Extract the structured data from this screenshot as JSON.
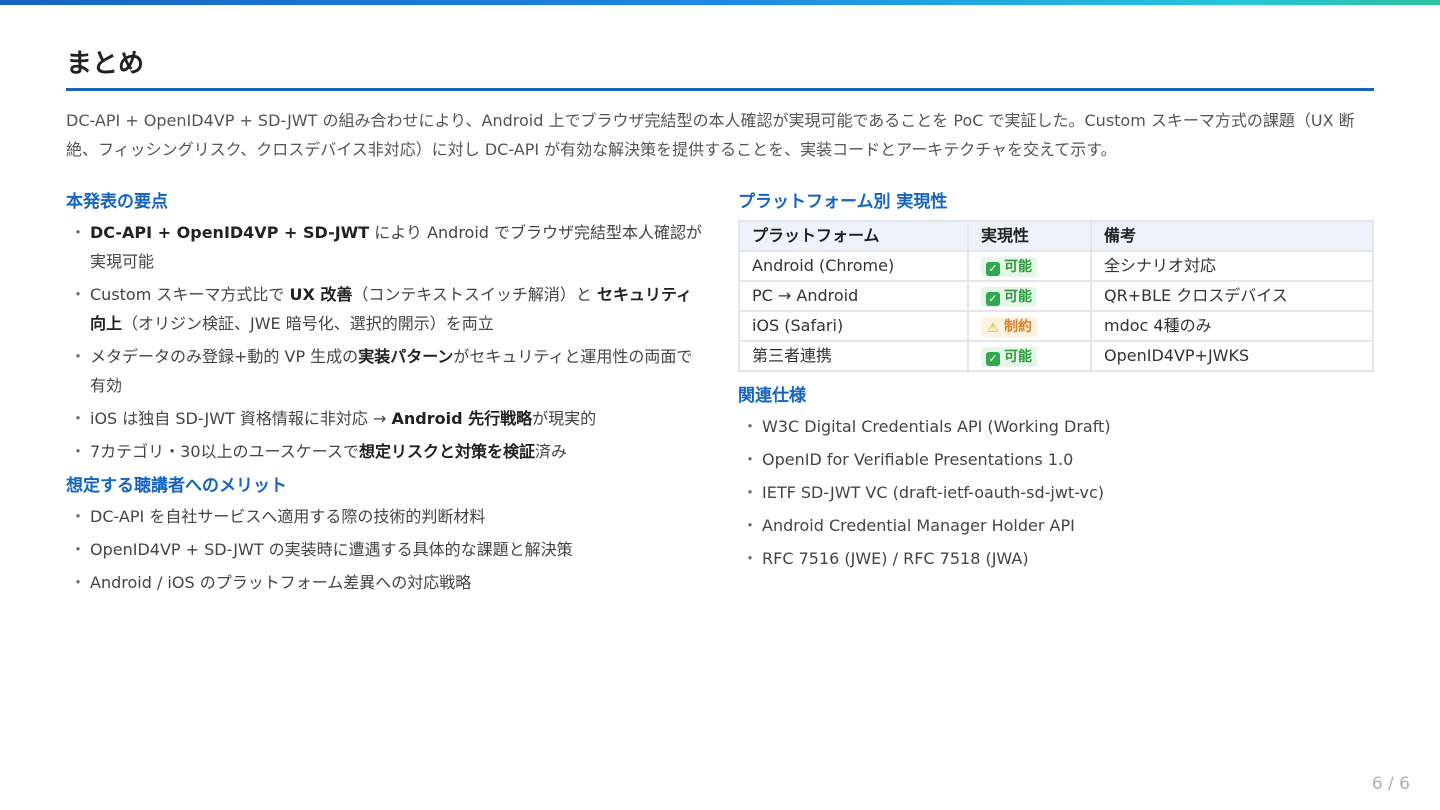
{
  "slide": {
    "title": "まとめ",
    "intro": "DC-API + OpenID4VP + SD-JWT の組み合わせにより、Android 上でブラウザ完結型の本人確認が実現可能であることを PoC で実証した。Custom スキーマ方式の課題（UX 断絶、フィッシングリスク、クロスデバイス非対応）に対し DC-API が有効な解決策を提供することを、実装コードとアーキテクチャを交えて示す。",
    "page_number": "6 / 6"
  },
  "key_points": {
    "heading": "本発表の要点",
    "items": [
      [
        {
          "t": "DC-API + OpenID4VP + SD-JWT",
          "b": true
        },
        {
          "t": " により Android でブラウザ完結型本人確認が実現可能"
        }
      ],
      [
        {
          "t": "Custom スキーマ方式比で "
        },
        {
          "t": "UX 改善",
          "b": true
        },
        {
          "t": "（コンテキストスイッチ解消）と "
        },
        {
          "t": "セキュリティ向上",
          "b": true
        },
        {
          "t": "（オリジン検証、JWE 暗号化、選択的開示）を両立"
        }
      ],
      [
        {
          "t": "メタデータのみ登録+動的 VP 生成の"
        },
        {
          "t": "実装パターン",
          "b": true
        },
        {
          "t": "がセキュリティと運用性の両面で有効"
        }
      ],
      [
        {
          "t": "iOS は独自 SD-JWT 資格情報に非対応 → "
        },
        {
          "t": "Android 先行戦略",
          "b": true
        },
        {
          "t": "が現実的"
        }
      ],
      [
        {
          "t": "7カテゴリ・30以上のユースケースで"
        },
        {
          "t": "想定リスクと対策を検証",
          "b": true
        },
        {
          "t": "済み"
        }
      ]
    ]
  },
  "audience_benefits": {
    "heading": "想定する聴講者へのメリット",
    "items": [
      "DC-API を自社サービスへ適用する際の技術的判断材料",
      "OpenID4VP + SD-JWT の実装時に遭遇する具体的な課題と解決策",
      "Android / iOS のプラットフォーム差異への対応戦略"
    ]
  },
  "platform_table": {
    "heading": "プラットフォーム別 実現性",
    "columns": [
      "プラットフォーム",
      "実現性",
      "備考"
    ],
    "rows": [
      {
        "platform": "Android (Chrome)",
        "status": "可能",
        "status_type": "ok",
        "icon": "check-icon",
        "note": "全シナリオ対応"
      },
      {
        "platform": "PC → Android",
        "status": "可能",
        "status_type": "ok",
        "icon": "check-icon",
        "note": "QR+BLE クロスデバイス"
      },
      {
        "platform": "iOS (Safari)",
        "status": "制約",
        "status_type": "warn",
        "icon": "warning-icon",
        "note": "mdoc 4種のみ"
      },
      {
        "platform": "第三者連携",
        "status": "可能",
        "status_type": "ok",
        "icon": "check-icon",
        "note": "OpenID4VP+JWKS"
      }
    ],
    "colors": {
      "ok": "#2e9a3e",
      "warn": "#d9822b",
      "accent": "#1565c0"
    }
  },
  "related_specs": {
    "heading": "関連仕様",
    "items": [
      "W3C Digital Credentials API (Working Draft)",
      "OpenID for Verifiable Presentations 1.0",
      "IETF SD-JWT VC (draft-ietf-oauth-sd-jwt-vc)",
      "Android Credential Manager Holder API",
      "RFC 7516 (JWE) / RFC 7518 (JWA)"
    ]
  }
}
